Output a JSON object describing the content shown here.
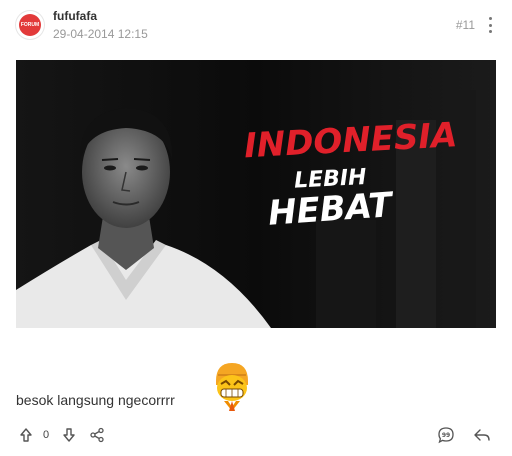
{
  "post": {
    "username": "fufufafa",
    "timestamp": "29-04-2014 12:15",
    "post_number": "#11",
    "avatar_text": "FORUM",
    "image": {
      "headline_line1": "INDONESIA",
      "headline_line2": "LEBIH",
      "headline_line3": "HEBAT",
      "headline_accent_color": "#e0202a",
      "headline_text_color": "#ffffff"
    },
    "body_text": "besok langsung ngecorrrr",
    "emoji": "grinning-helmet-emoji",
    "vote_count": "0"
  },
  "icons": {
    "more": "more-vertical-icon",
    "upvote": "arrow-up-icon",
    "downvote": "arrow-down-icon",
    "share": "share-icon",
    "quote": "quote-bubble-icon",
    "reply": "reply-icon"
  },
  "colors": {
    "text": "#333333",
    "muted": "#999999",
    "avatar_bg": "#e23a3a"
  }
}
